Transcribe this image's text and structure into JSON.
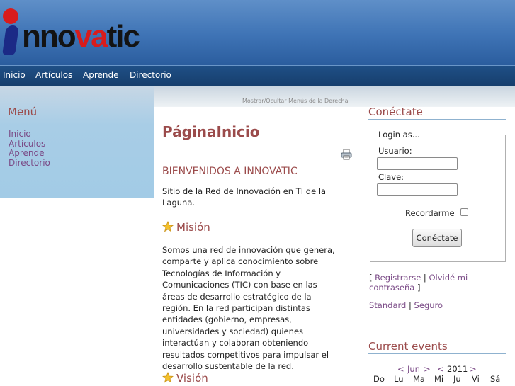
{
  "logo": {
    "prefix": "nno",
    "accent": "va",
    "suffix": "tic"
  },
  "nav": [
    "Inicio",
    "Artículos",
    "Aprende",
    "Directorio"
  ],
  "subbar": {
    "faded": "",
    "toggle": "Mostrar/Ocultar Menús de la Derecha"
  },
  "left_menu": {
    "title": "Menú",
    "items": [
      "Inicio",
      "Artículos",
      "Aprende",
      "Directorio"
    ]
  },
  "main": {
    "title": "PáginaInicio",
    "welcome": "BIENVENIDOS A INNOVATIC",
    "intro": "Sitio de la Red de Innovación en TI de la Laguna.",
    "mision_title": "Misión",
    "mision_text": "Somos una red de innovación que genera, comparte y aplica conocimiento sobre Tecnologías de Información y Comunicaciones (TIC) con base en las áreas de desarrollo estratégico de la región. En la red participan distintas entidades (gobierno, empresas, universidades y sociedad) quienes interactúan y colaboran obteniendo resultados competitivos para impulsar el desarrollo sustentable de la red.",
    "vision_title": "Visión"
  },
  "login": {
    "title": "Conéctate",
    "legend": "Login as...",
    "user_label": "Usuario:",
    "pass_label": "Clave:",
    "remember_label": "Recordarme",
    "button": "Conéctate",
    "register": "Registrarse",
    "forgot_line1": "Olvidé mi",
    "forgot_line2": "contraseña",
    "standard": "Standard",
    "secure": "Seguro"
  },
  "events": {
    "title": "Current events",
    "prev_month": "<",
    "month": "Jun",
    "next_month": ">",
    "prev_year": "<",
    "year": "2011",
    "next_year": ">",
    "days": [
      "Do",
      "Lu",
      "Ma",
      "Mi",
      "Ju",
      "Vi",
      "Sá"
    ]
  },
  "colors": {
    "header": "#3e73b5",
    "nav": "#1f4f86",
    "heading": "#9b4b4b",
    "link": "#7a4a86",
    "sidebar": "#a8cde6"
  }
}
